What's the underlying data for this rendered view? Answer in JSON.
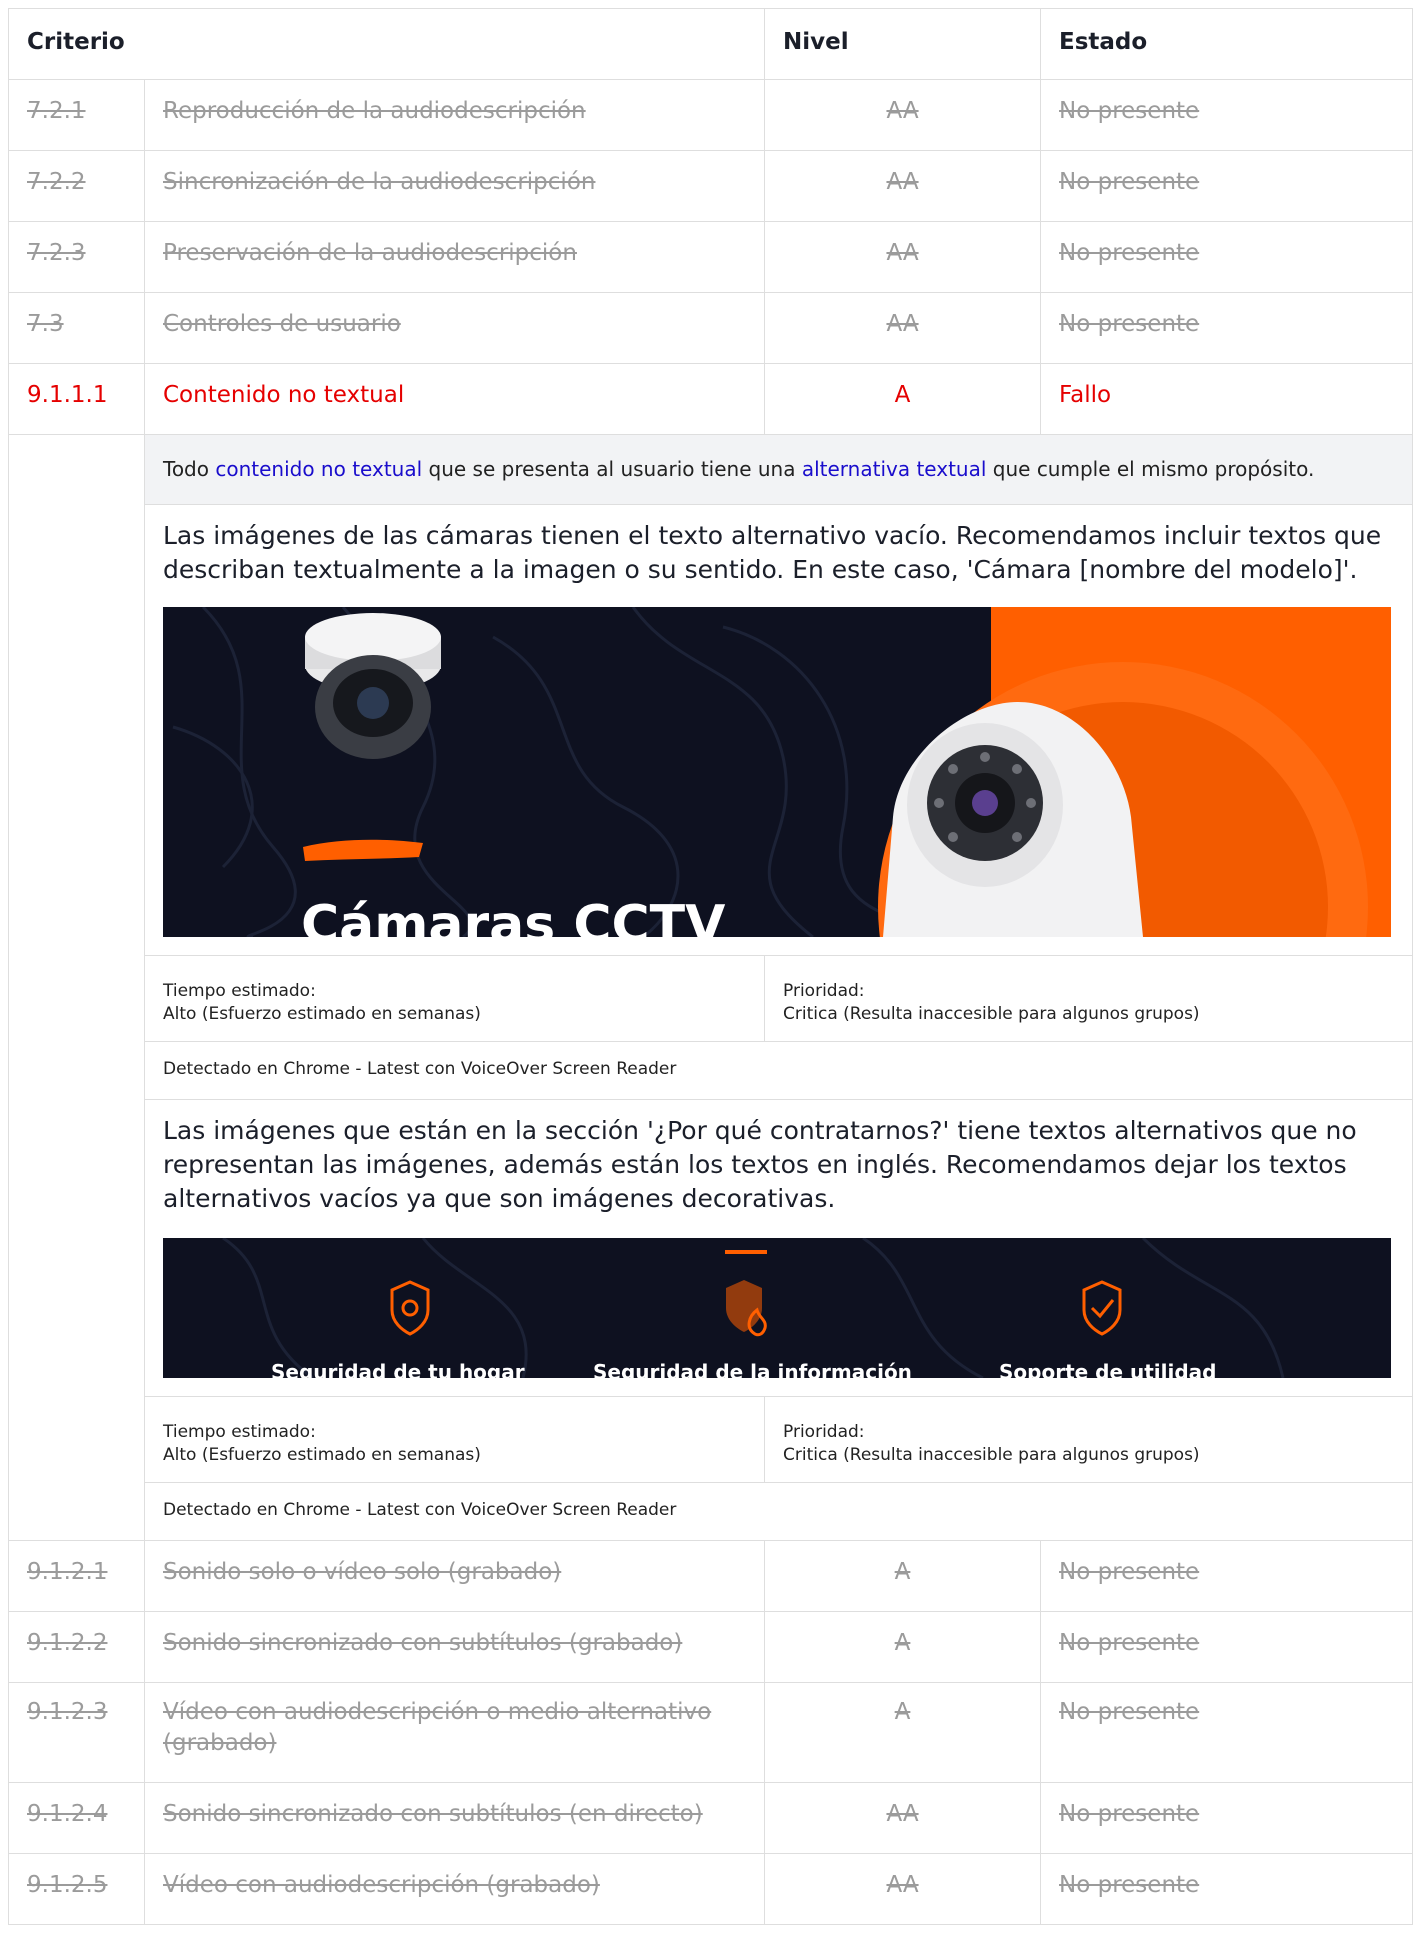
{
  "header": {
    "criterio": "Criterio",
    "nivel": "Nivel",
    "estado": "Estado"
  },
  "rows_before": [
    {
      "id": "7.2.1",
      "name": "Reproducción de la audiodescripción",
      "level": "AA",
      "status": "No presente"
    },
    {
      "id": "7.2.2",
      "name": "Sincronización de la audiodescripción",
      "level": "AA",
      "status": "No presente"
    },
    {
      "id": "7.2.3",
      "name": "Preservación de la audiodescripción",
      "level": "AA",
      "status": "No presente"
    },
    {
      "id": "7.3",
      "name": "Controles de usuario",
      "level": "AA",
      "status": "No presente"
    }
  ],
  "fail_row": {
    "id": "9.1.1.1",
    "name": "Contenido no textual",
    "level": "A",
    "status": "Fallo",
    "description": {
      "part1": "Todo ",
      "link1": "contenido no textual",
      "part2": " que se presenta al usuario tiene una ",
      "link2": "alternativa textual",
      "part3": " que cumple el mismo propósito."
    },
    "issues": [
      {
        "text": "Las imágenes de las cámaras tienen el texto alternativo vacío. Recomendamos incluir textos que describan textualmente a la imagen o su sentido. En este caso, 'Cámara [nombre del modelo]'.",
        "image_text": "Cámaras CCTV",
        "time_label": "Tiempo estimado:",
        "time_value": "Alto (Esfuerzo estimado en semanas)",
        "priority_label": "Prioridad:",
        "priority_value": "Critica (Resulta inaccesible para algunos grupos)",
        "detected": "Detectado en Chrome - Latest con VoiceOver Screen Reader"
      },
      {
        "text": "Las imágenes que están en la sección '¿Por qué contratarnos?' tiene textos alternativos que no representan las imágenes, además están los textos en inglés. Recomendamos dejar los textos alternativos vacíos ya que son imágenes decorativas.",
        "image_texts": [
          "Seguridad de tu hogar",
          "Seguridad de la información",
          "Soporte de utilidad"
        ],
        "time_label": "Tiempo estimado:",
        "time_value": "Alto (Esfuerzo estimado en semanas)",
        "priority_label": "Prioridad:",
        "priority_value": "Critica (Resulta inaccesible para algunos grupos)",
        "detected": "Detectado en Chrome - Latest con VoiceOver Screen Reader"
      }
    ]
  },
  "rows_after": [
    {
      "id": "9.1.2.1",
      "name": "Sonido solo o vídeo solo (grabado)",
      "level": "A",
      "status": "No presente"
    },
    {
      "id": "9.1.2.2",
      "name": "Sonido sincronizado con subtítulos (grabado)",
      "level": "A",
      "status": "No presente"
    },
    {
      "id": "9.1.2.3",
      "name": "Vídeo con audiodescripción o medio alternativo (grabado)",
      "level": "A",
      "status": "No presente"
    },
    {
      "id": "9.1.2.4",
      "name": "Sonido sincronizado con subtítulos (en directo)",
      "level": "AA",
      "status": "No presente"
    },
    {
      "id": "9.1.2.5",
      "name": "Vídeo con audiodescripción (grabado)",
      "level": "AA",
      "status": "No presente"
    }
  ],
  "colors": {
    "fail": "#e50000",
    "muted": "#9b9b9b",
    "link": "#1a0dcc",
    "banner_dark": "#0e1120",
    "banner_orange": "#ff5f00"
  }
}
